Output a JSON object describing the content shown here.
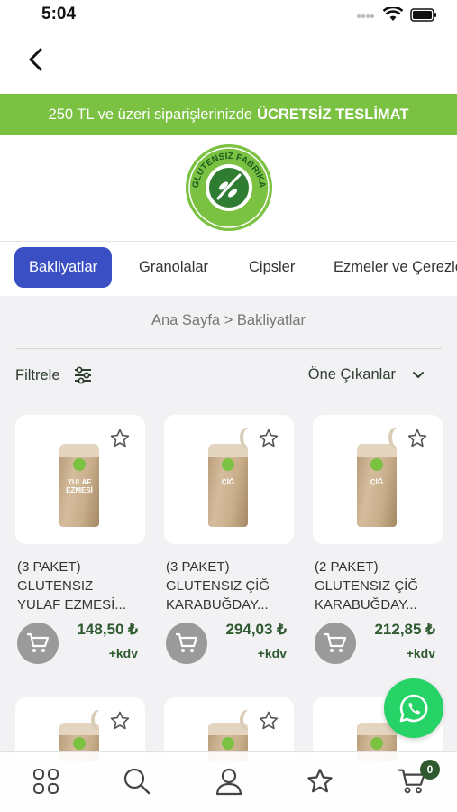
{
  "status": {
    "time": "5:04"
  },
  "promo": {
    "text": "250 TL ve üzeri siparişlerinizde",
    "bold": "ÜCRETSİZ TESLİMAT"
  },
  "logo": {
    "text": "GLUTENSIZ FABRIKA"
  },
  "categories": [
    "Bakliyatlar",
    "Granolalar",
    "Cipsler",
    "Ezmeler ve Çerezler"
  ],
  "breadcrumb": {
    "home": "Ana Sayfa",
    "sep": ">",
    "current": "Bakliyatlar"
  },
  "filter": {
    "label": "Filtrele"
  },
  "sort": {
    "label": "Öne Çıkanlar"
  },
  "products": [
    {
      "line1": "(3 PAKET)",
      "line2": "GLUTENSIZ",
      "line3": "YULAF EZMESİ...",
      "price": "148,50 ₺",
      "tax": "+kdv",
      "bag_label": "YULAF EZMESİ"
    },
    {
      "line1": "(3 PAKET)",
      "line2": "GLUTENSIZ ÇİĞ",
      "line3": "KARABUĞDAY...",
      "price": "294,03 ₺",
      "tax": "+kdv",
      "bag_label": "ÇİĞ"
    },
    {
      "line1": "(2 PAKET)",
      "line2": "GLUTENSIZ ÇİĞ",
      "line3": "KARABUĞDAY...",
      "price": "212,85 ₺",
      "tax": "+kdv",
      "bag_label": "ÇİĞ"
    }
  ],
  "cart": {
    "count": "0"
  },
  "colors": {
    "brand_green": "#7bc142",
    "accent_blue": "#3b4fc4",
    "price_green": "#2f5a2f",
    "whatsapp": "#25d366"
  }
}
